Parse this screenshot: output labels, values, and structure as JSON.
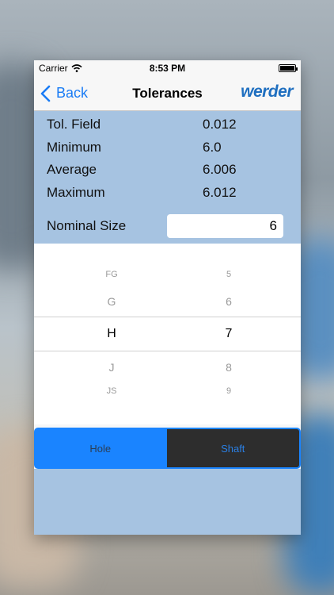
{
  "status_bar": {
    "carrier": "Carrier",
    "time": "8:53 PM"
  },
  "nav": {
    "back_label": "Back",
    "title": "Tolerances",
    "brand": "werder"
  },
  "info": {
    "rows": [
      {
        "label": "Tol. Field",
        "value": "0.012"
      },
      {
        "label": "Minimum",
        "value": "6.0"
      },
      {
        "label": "Average",
        "value": "6.006"
      },
      {
        "label": "Maximum",
        "value": "6.012"
      }
    ]
  },
  "nominal": {
    "label": "Nominal Size",
    "value": "6"
  },
  "picker": {
    "letters": [
      "FG",
      "G",
      "H",
      "J",
      "JS"
    ],
    "numbers": [
      "5",
      "6",
      "7",
      "8",
      "9"
    ],
    "selected_letter": "H",
    "selected_number": "7"
  },
  "tabs": {
    "hole_label": "Hole",
    "shaft_label": "Shaft",
    "selected": "Hole"
  },
  "colors": {
    "accent": "#1a84ff",
    "panel": "#a6c3e1",
    "brand": "#1f6fc0"
  }
}
